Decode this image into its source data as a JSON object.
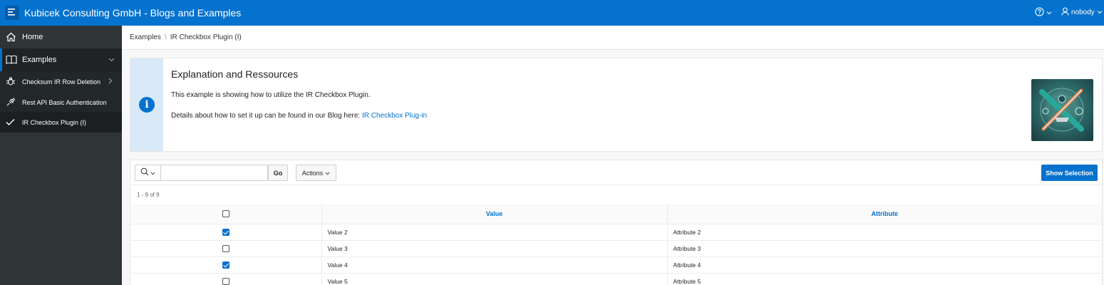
{
  "header": {
    "app_title": "Kubicek Consulting GmbH - Blogs and Examples",
    "user_name": "nobody",
    "icons": [
      "menu-icon",
      "help-icon",
      "user-icon",
      "chevron-down-icon"
    ]
  },
  "sidebar": {
    "items": [
      {
        "label": "Home",
        "icon": "home-icon"
      },
      {
        "label": "Examples",
        "icon": "book-icon"
      },
      {
        "label": "Checksum IR Row Deletion",
        "icon": "bug-icon"
      },
      {
        "label": "Rest API Basic Authentication",
        "icon": "plug-icon"
      },
      {
        "label": "IR Checkbox Plugin (I)",
        "icon": "check-icon"
      }
    ]
  },
  "breadcrumb": {
    "parent": "Examples",
    "separator": "\\",
    "current": "IR Checkbox Plugin (I)"
  },
  "info_region": {
    "title": "Explanation and Ressources",
    "line1": "This example is showing how to utilize the IR Checkbox Plugin.",
    "line2_prefix": "Details about how to set it up can be found in our Blog here: ",
    "link_text": "IR Checkbox Plug-in"
  },
  "report": {
    "search_placeholder": "",
    "go_label": "Go",
    "actions_label": "Actions",
    "show_selection_label": "Show Selection",
    "pagination": "1 - 9 of 9",
    "columns": [
      "Value",
      "Attribute"
    ],
    "rows": [
      {
        "checked": true,
        "value": "Value 2",
        "attribute": "Attribute 2"
      },
      {
        "checked": false,
        "value": "Value 3",
        "attribute": "Attribute 3"
      },
      {
        "checked": true,
        "value": "Value 4",
        "attribute": "Attribute 4"
      },
      {
        "checked": false,
        "value": "Value 5",
        "attribute": "Attribute 5"
      }
    ]
  },
  "colors": {
    "brand_blue": "#0572ce",
    "sidebar_bg": "#2f3437"
  }
}
